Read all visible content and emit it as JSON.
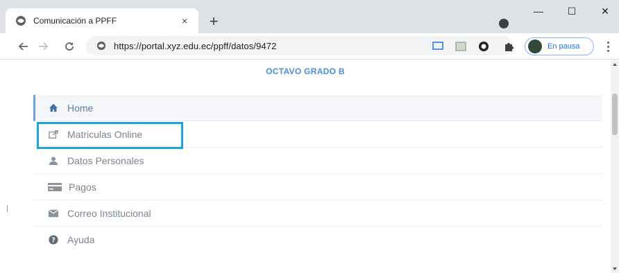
{
  "browser": {
    "tab_title": "Comunicación a PPFF",
    "url": "https://portal.xyz.edu.ec/ppff/datos/9472",
    "profile_label": "En pausa",
    "close_glyph": "×",
    "new_tab_glyph": "+",
    "minimize_glyph": "—",
    "maximize_glyph": "☐",
    "window_close_glyph": "✕"
  },
  "page": {
    "grade_title": "OCTAVO GRADO B"
  },
  "menu": {
    "items": [
      {
        "label": "Home",
        "icon": "home-icon"
      },
      {
        "label": "Matriculas Online",
        "icon": "share-icon"
      },
      {
        "label": "Datos Personales",
        "icon": "user-icon"
      },
      {
        "label": "Pagos",
        "icon": "credit-card-icon"
      },
      {
        "label": "Correo Institucional",
        "icon": "envelope-icon"
      },
      {
        "label": "Ayuda",
        "icon": "help-icon"
      }
    ],
    "active_item": "Home",
    "highlighted_item": "Matriculas Online"
  },
  "colors": {
    "accent": "#4a90d9",
    "highlight_border": "#1aa3dd",
    "menu_text": "#7a8591"
  }
}
